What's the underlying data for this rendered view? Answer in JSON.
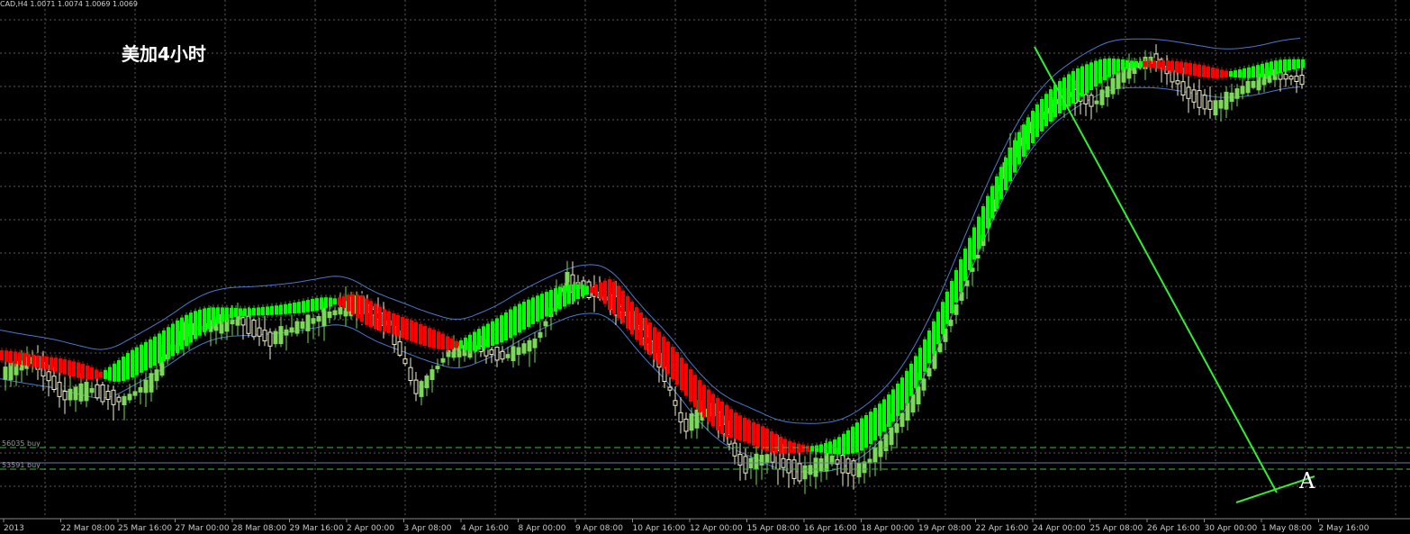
{
  "header": {
    "symbol_info": "CAD,H4  1.0071 1.0074 1.0069 1.0069"
  },
  "chart_title": "美加4小时",
  "point_label": "A",
  "order_lines": [
    {
      "label": "56035 buy"
    },
    {
      "label": "53591 buy"
    }
  ],
  "colors": {
    "background": "#000000",
    "grid": "#5a5a5a",
    "bull_candle": "#7bd85a",
    "bear_candle": "#f0f0c8",
    "trend_up": "#00ff00",
    "trend_down": "#ff0000",
    "envelope": "#4a78c8",
    "trendline": "#33ee33",
    "order_line": "#38c038"
  },
  "chart_data": {
    "type": "candlestick",
    "title": "美加4小时",
    "symbol": "CAD,H4",
    "timeframe": "H4",
    "ohlc_header": {
      "open": 1.0071,
      "high": 1.0074,
      "low": 1.0069,
      "close": 1.0069
    },
    "x_tick_labels": [
      "2013",
      "22 Mar 08:00",
      "25 Mar 16:00",
      "27 Mar 00:00",
      "28 Mar 08:00",
      "29 Mar 16:00",
      "2 Apr 00:00",
      "3 Apr 08:00",
      "4 Apr 16:00",
      "8 Apr 00:00",
      "9 Apr 08:00",
      "10 Apr 16:00",
      "12 Apr 00:00",
      "15 Apr 08:00",
      "16 Apr 16:00",
      "18 Apr 00:00",
      "19 Apr 08:00",
      "22 Apr 16:00",
      "24 Apr 00:00",
      "25 Apr 08:00",
      "26 Apr 16:00",
      "30 Apr 00:00",
      "1 May 08:00",
      "2 May 16:00"
    ],
    "price_path": [
      0.55,
      0.6,
      0.47,
      0.49,
      0.45,
      0.52,
      0.7,
      0.72,
      0.74,
      0.67,
      0.72,
      0.76,
      0.8,
      0.73,
      0.48,
      0.62,
      0.64,
      0.61,
      0.66,
      0.88,
      0.84,
      0.77,
      0.64,
      0.36,
      0.42,
      0.22,
      0.25,
      0.19,
      0.24,
      0.2,
      0.32,
      0.48,
      0.72,
      0.98,
      1.32,
      1.46,
      1.55,
      1.52,
      1.63,
      1.68,
      1.56,
      1.5,
      1.57,
      1.62,
      1.6
    ],
    "annotations": [
      {
        "type": "trendline",
        "description": "descending trendline from 24 Apr peak to 1 May low"
      },
      {
        "type": "trendline",
        "description": "short rising support line near 1-2 May lows"
      },
      {
        "type": "label",
        "text": "A"
      }
    ],
    "overlays": [
      "upper envelope band",
      "lower envelope band",
      "trend-colored moving average (red = down, green = up)",
      "two dashed buy-order lines"
    ],
    "grid": true,
    "legend": "none"
  }
}
